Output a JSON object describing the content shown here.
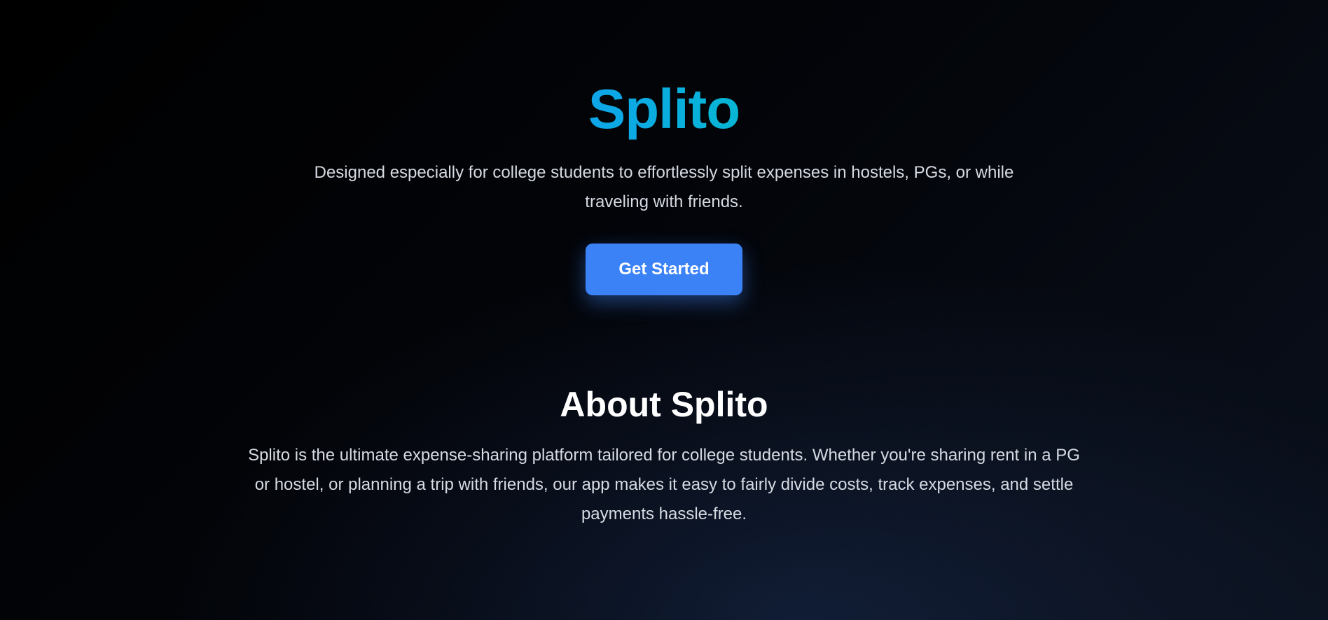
{
  "hero": {
    "title": "Splito",
    "description": "Designed especially for college students to effortlessly split expenses in hostels, PGs, or while traveling with friends.",
    "cta_label": "Get Started"
  },
  "about": {
    "title": "About Splito",
    "description": "Splito is the ultimate expense-sharing platform tailored for college students. Whether you're sharing rent in a PG or hostel, or planning a trip with friends, our app makes it easy to fairly divide costs, track expenses, and settle payments hassle-free."
  },
  "colors": {
    "brand_gradient_start": "#0ea5e9",
    "brand_gradient_end": "#06b6d4",
    "cta_background": "#3b82f6",
    "page_background": "#000000",
    "body_text": "#d6dae2"
  }
}
